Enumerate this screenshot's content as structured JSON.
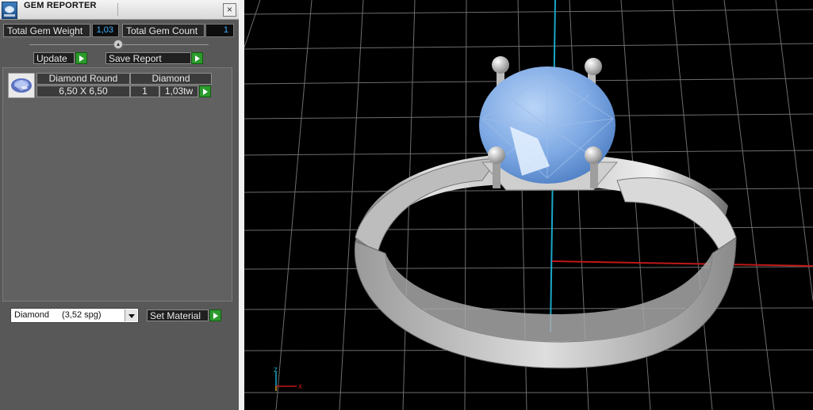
{
  "window": {
    "title": "GEM REPORTER",
    "close_glyph": "×"
  },
  "totals": {
    "weight_label": "Total Gem Weight",
    "weight_value": "1,03",
    "count_label": "Total Gem Count",
    "count_value": "1"
  },
  "actions": {
    "update_label": "Update",
    "save_report_label": "Save Report"
  },
  "gem_table": {
    "header": [
      "Diamond Round",
      "Diamond"
    ],
    "rows": [
      {
        "size": "6,50 X 6,50",
        "count": "1",
        "weight": "1,03tw"
      }
    ]
  },
  "material": {
    "name": "Diamond",
    "spg": "(3,52 spg)",
    "set_label": "Set Material"
  },
  "viewport": {
    "axis_indicator": {
      "z_label": "z",
      "x_label": "x"
    },
    "colors": {
      "background": "#000000",
      "grid": "#7a7a7a",
      "axis_x": "#c01818",
      "axis_z": "#1aa7c8",
      "gem": "#6d9fe0",
      "metal": "#d6d6d6"
    }
  }
}
